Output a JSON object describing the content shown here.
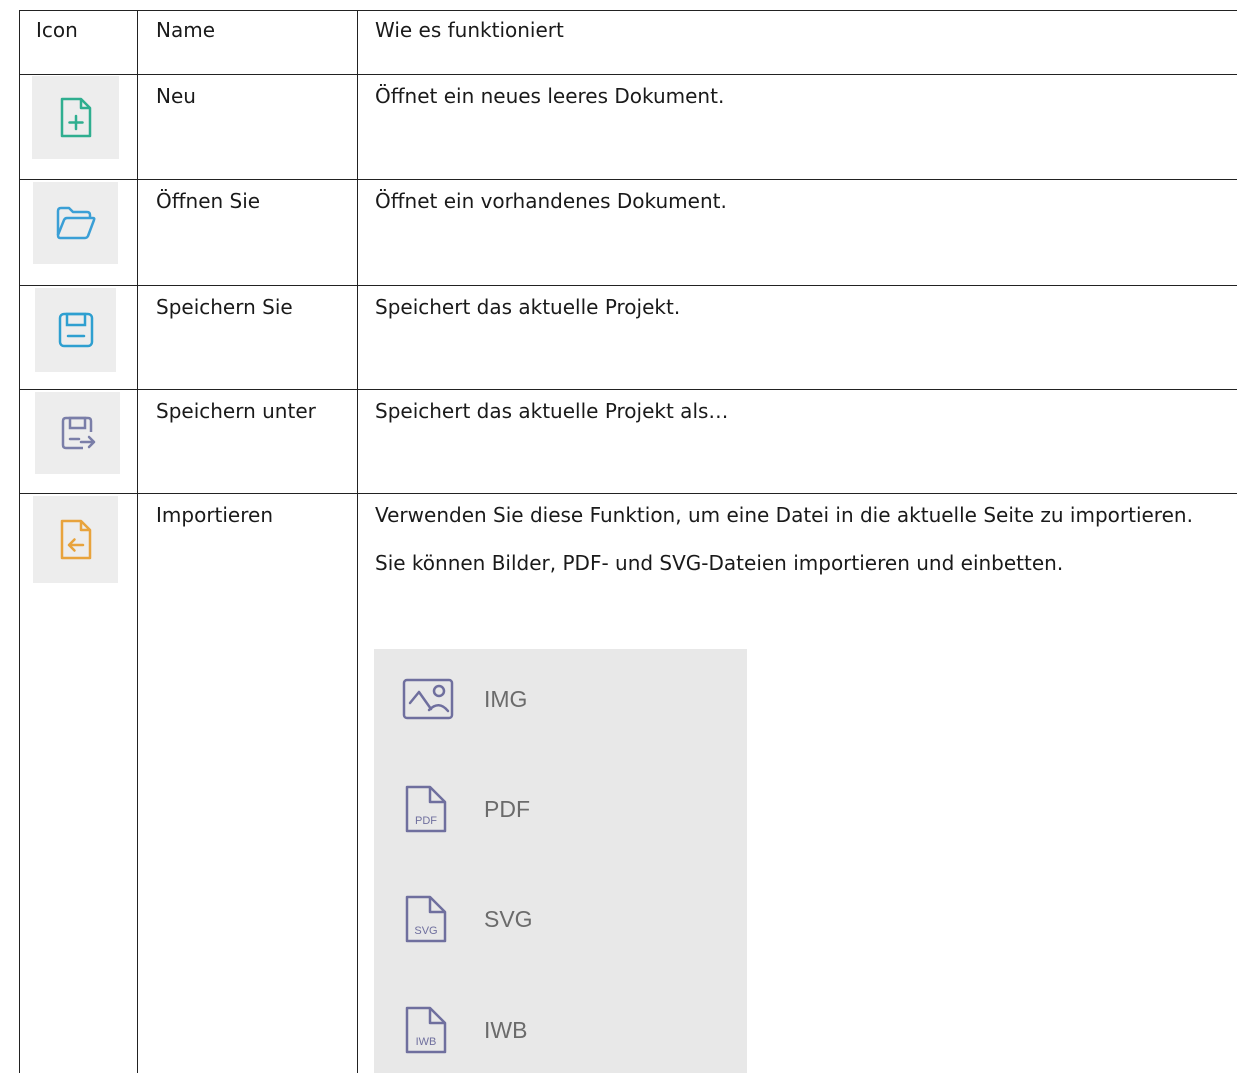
{
  "table": {
    "headers": {
      "icon": "Icon",
      "name": "Name",
      "description": "Wie es funktioniert"
    },
    "rows": [
      {
        "icon": "new-document-icon",
        "icon_color": "#2fae8f",
        "name": "Neu",
        "description": "Öffnet ein neues leeres Dokument."
      },
      {
        "icon": "open-folder-icon",
        "icon_color": "#3a9fd6",
        "name": "Öffnen Sie",
        "description": "Öffnet ein vorhandenes Dokument."
      },
      {
        "icon": "save-icon",
        "icon_color": "#2e9fd0",
        "name": "Speichern Sie",
        "description": "Speichert das aktuelle Projekt."
      },
      {
        "icon": "save-as-icon",
        "icon_color": "#7a7ea8",
        "name": "Speichern unter",
        "description": "Speichert das aktuelle Projekt als…"
      },
      {
        "icon": "import-icon",
        "icon_color": "#e8a33c",
        "name": "Importieren",
        "description": "Verwenden Sie diese Funktion, um eine Datei in die aktuelle Seite zu importieren. Sie können Bilder, PDF- und SVG-Dateien importieren und einbetten."
      }
    ]
  },
  "import_menu": {
    "items": [
      {
        "icon": "image-file-icon",
        "label": "IMG"
      },
      {
        "icon": "pdf-file-icon",
        "label": "PDF",
        "badge": "PDF"
      },
      {
        "icon": "svg-file-icon",
        "label": "SVG",
        "badge": "SVG"
      },
      {
        "icon": "iwb-file-icon",
        "label": "IWB",
        "badge": "IWB"
      }
    ],
    "icon_color": "#6f6f9e"
  }
}
